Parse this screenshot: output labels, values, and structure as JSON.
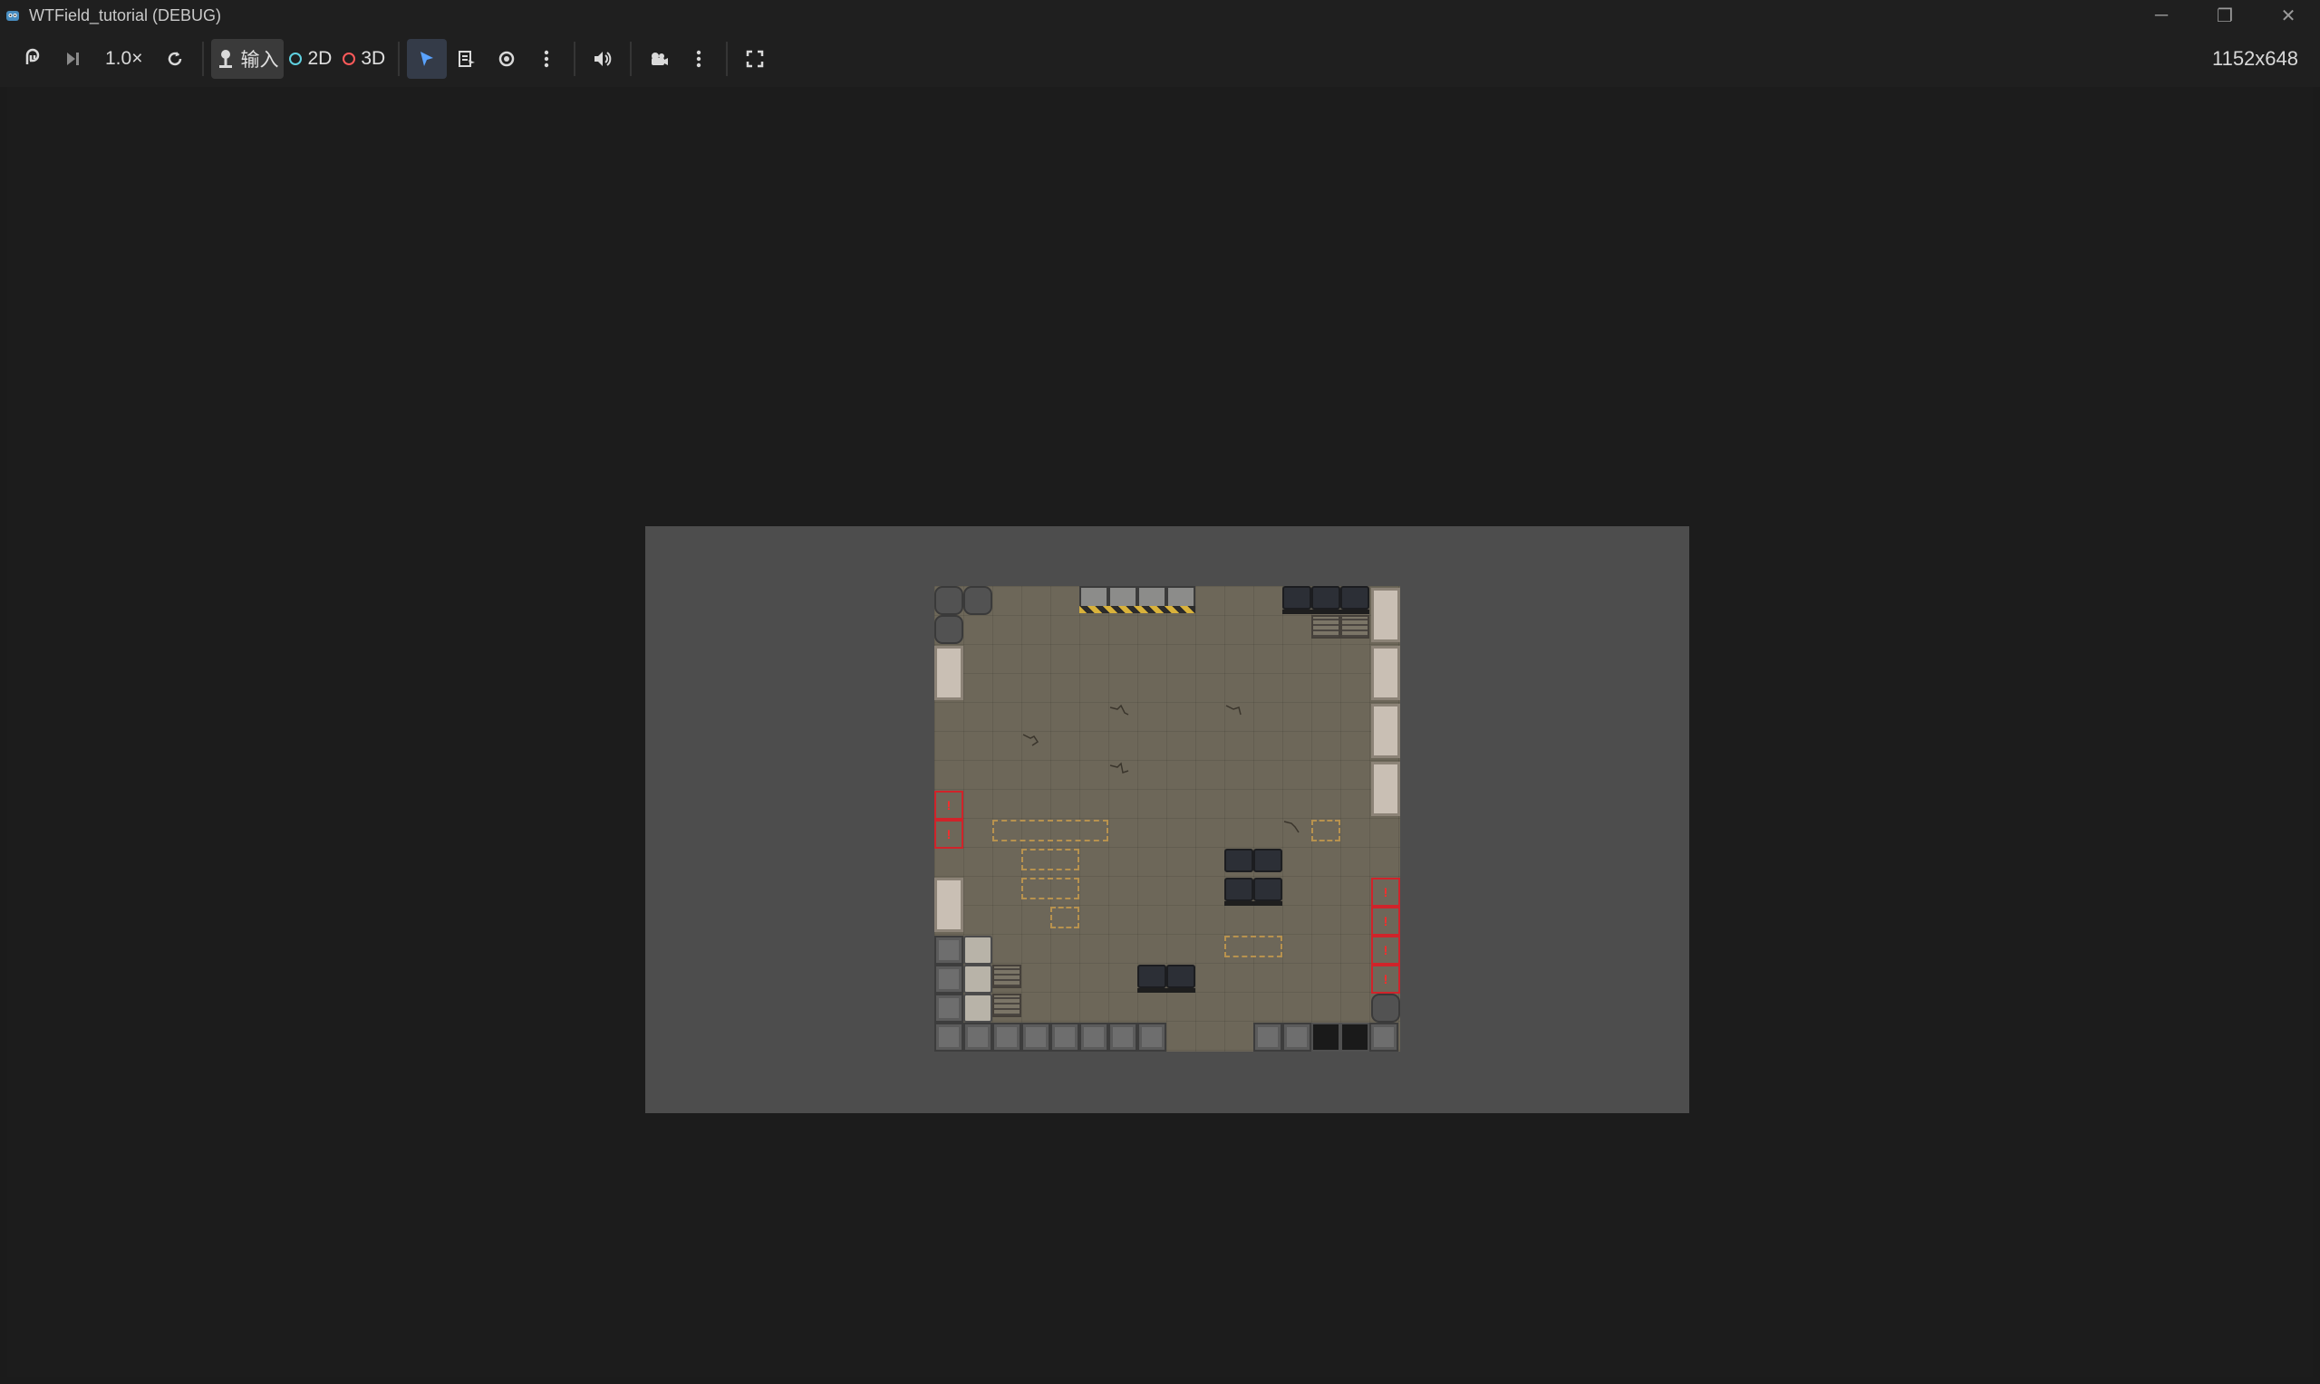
{
  "window": {
    "title": "WTField_tutorial (DEBUG)",
    "minimize": "─",
    "maximize": "❐",
    "close": "✕"
  },
  "toolbar": {
    "speed": "1.0×",
    "input_label": "输入",
    "mode_2d": "2D",
    "mode_3d": "3D",
    "resolution": "1152x648"
  },
  "colors": {
    "background": "#1b1b1b",
    "canvas": "#4d4d4d",
    "floor": "#6d6759",
    "alert": "#d0232a",
    "accent_2d": "#5fd1e0",
    "accent_3d": "#ff5a5a"
  },
  "game": {
    "alert_glyph": "!"
  }
}
